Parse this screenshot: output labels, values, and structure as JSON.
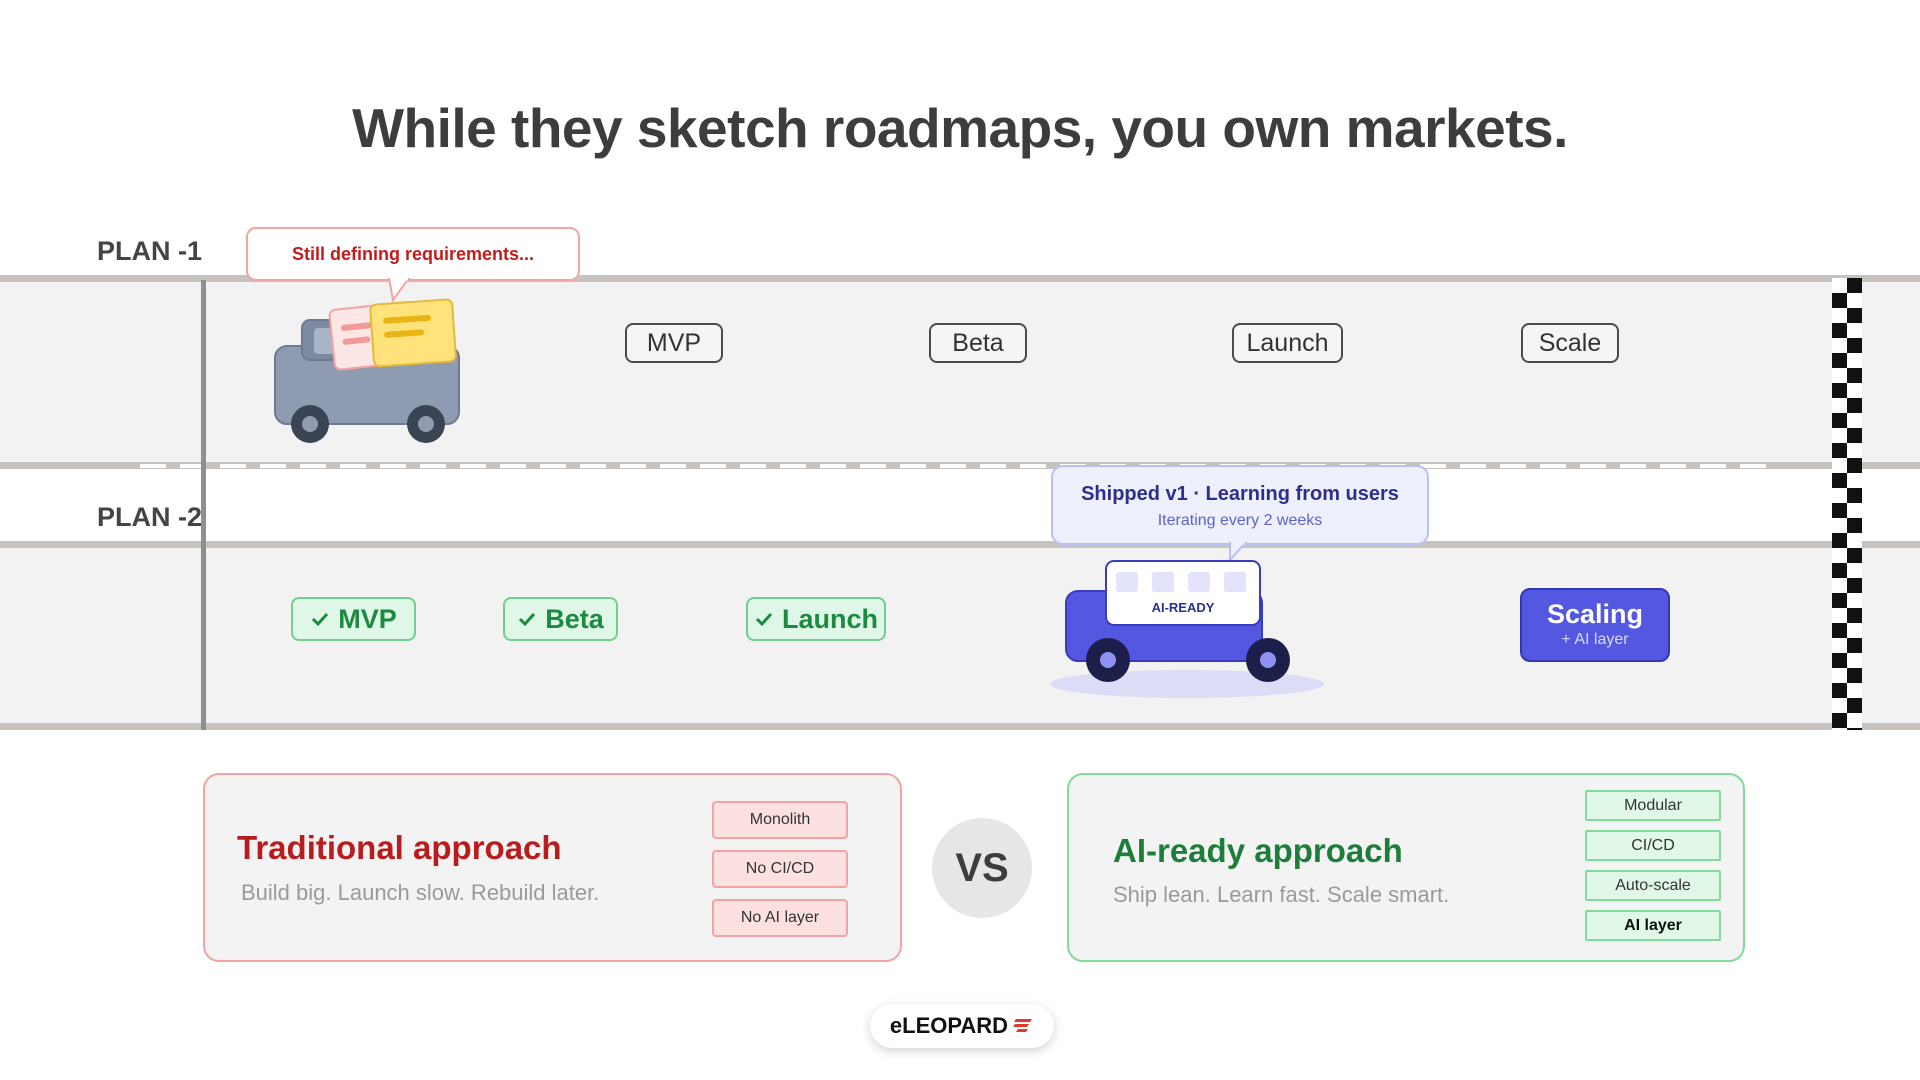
{
  "headline": "While they sketch roadmaps, you own markets.",
  "plans": {
    "plan1_label": "PLAN -1",
    "plan2_label": "PLAN -2"
  },
  "lane1": {
    "bubble_text": "Still defining requirements...",
    "milestones": [
      "MVP",
      "Beta",
      "Launch",
      "Scale"
    ]
  },
  "lane2": {
    "completed": [
      "MVP",
      "Beta",
      "Launch"
    ],
    "bubble_title": "Shipped v1 · Learning from users",
    "bubble_subtitle": "Iterating every 2 weeks",
    "car_label": "AI-READY",
    "scaling_title": "Scaling",
    "scaling_subtitle": "+ AI layer"
  },
  "traditional": {
    "title": "Traditional approach",
    "subtitle": "Build big. Launch slow. Rebuild later.",
    "chips": [
      "Monolith",
      "No CI/CD",
      "No AI layer"
    ]
  },
  "vs_label": "VS",
  "ai_ready": {
    "title": "AI-ready approach",
    "subtitle": "Ship lean. Learn fast. Scale smart.",
    "chips": [
      "Modular",
      "CI/CD",
      "Auto-scale",
      "AI layer"
    ]
  },
  "brand": {
    "name": "eLEOPARD"
  },
  "colors": {
    "red_accent": "#c21c1c",
    "green_accent": "#1c8a3f",
    "indigo_accent": "#5457e0"
  }
}
